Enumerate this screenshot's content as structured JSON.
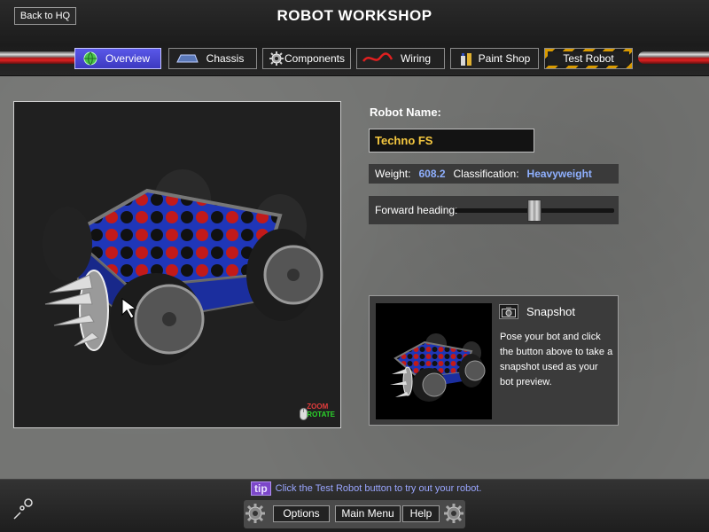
{
  "header": {
    "back_label": "Back to HQ",
    "title": "ROBOT WORKSHOP"
  },
  "tabs": [
    {
      "label": "Overview",
      "icon": "globe-icon",
      "active": true
    },
    {
      "label": "Chassis",
      "icon": "chassis-icon"
    },
    {
      "label": "Components",
      "icon": "gear-icon"
    },
    {
      "label": "Wiring",
      "icon": "wire-icon"
    },
    {
      "label": "Paint Shop",
      "icon": "paint-icon"
    },
    {
      "label": "Test Robot",
      "icon": "hazard-frame"
    }
  ],
  "viewport": {
    "zoom_hint": "ZOOM",
    "rotate_hint": "ROTATE"
  },
  "robot": {
    "name_label": "Robot Name:",
    "name_value": "Techno FS",
    "weight_label": "Weight:",
    "weight_value": "608.2",
    "classification_label": "Classification:",
    "classification_value": "Heavyweight",
    "heading_label": "Forward heading:",
    "heading_level": 0.5
  },
  "snapshot": {
    "title": "Snapshot",
    "description": "Pose your bot and click the button above to take a snapshot used as your bot preview."
  },
  "footer": {
    "tip_badge": "tip",
    "tip_text": "Click the Test Robot button to try out your robot.",
    "options_label": "Options",
    "main_menu_label": "Main Menu",
    "help_label": "Help"
  },
  "colors": {
    "accent_tab": "#4b48d8",
    "name_text": "#f5c840",
    "stat_value": "#8fb0ff",
    "hazard_yellow": "#d99a00"
  }
}
